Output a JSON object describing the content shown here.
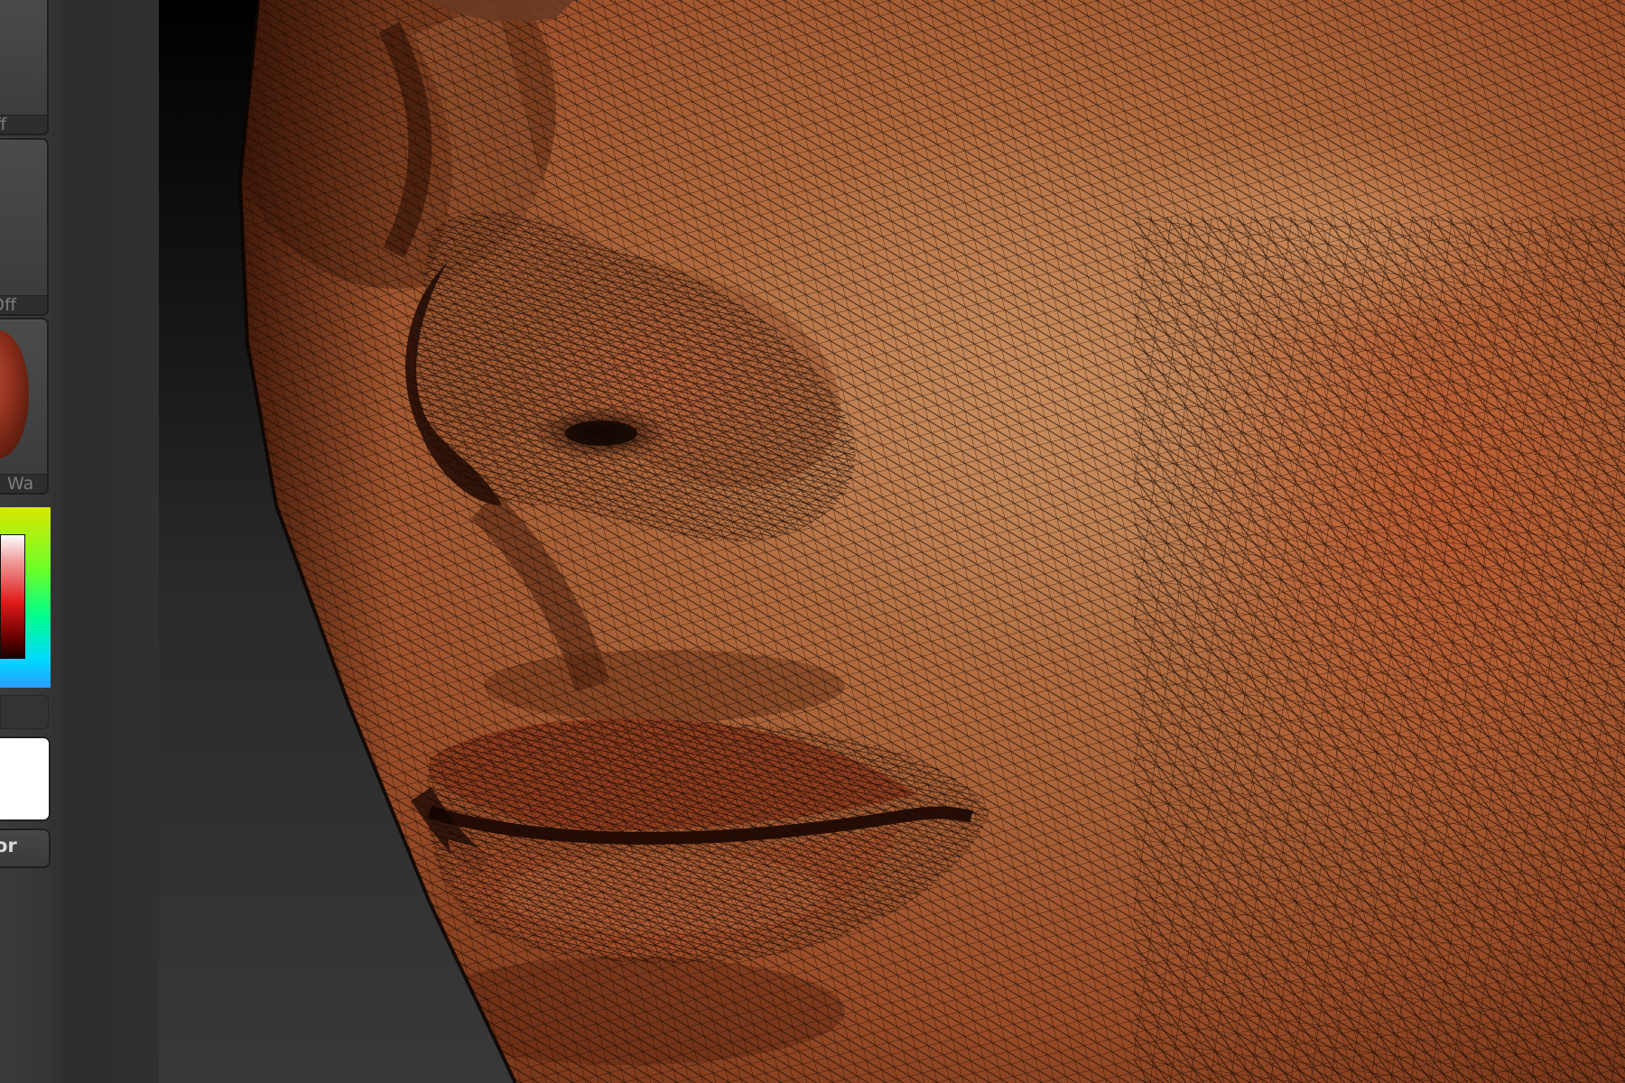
{
  "left_tray": {
    "buttons": [
      {
        "label": "ff"
      },
      {
        "label": "Off"
      },
      {
        "label": "Wa"
      }
    ],
    "color_button_label": "or"
  },
  "canvas": {
    "subject": "wireframe-face-closeup",
    "colors": {
      "skin_light": "#b07a50",
      "skin_mid": "#a85c35",
      "skin_dark": "#3a1406",
      "wire": "#1a0a04"
    }
  },
  "icons": {
    "material_preview": "material-sphere-icon",
    "color_picker": "color-picker-icon"
  }
}
